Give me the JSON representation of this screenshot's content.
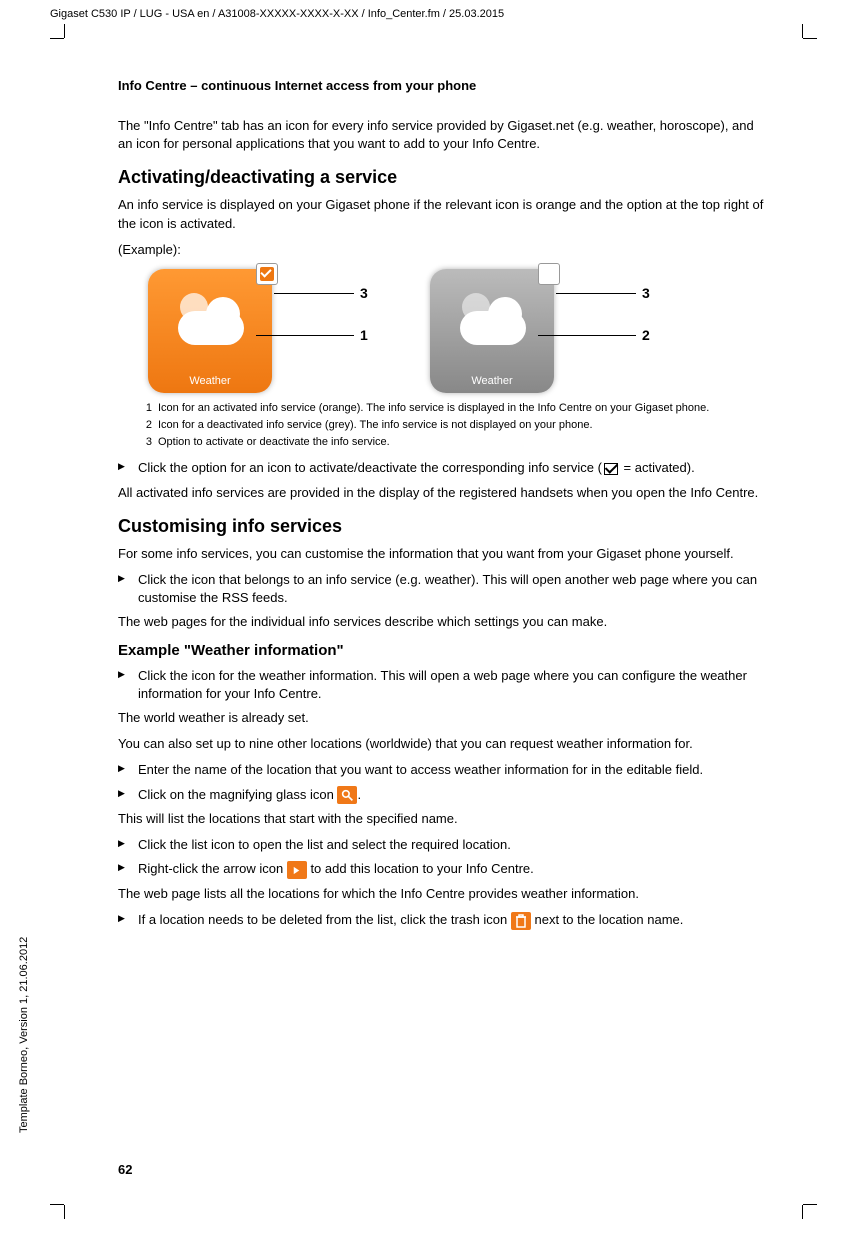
{
  "header": "Gigaset C530 IP / LUG - USA en / A31008-XXXXX-XXXX-X-XX / Info_Center.fm / 25.03.2015",
  "side": "Template Borneo, Version 1, 21.06.2012",
  "page_num": "62",
  "section_title": "Info Centre – continuous Internet access from your phone",
  "intro": "The \"Info Centre\" tab has an icon for every info service provided by Gigaset.net (e.g. weather, horoscope), and an icon for personal applications that you want to add to your Info Centre.",
  "h2_activate": "Activating/deactivating a service",
  "activate_p1": "An info service is displayed on your Gigaset phone if the relevant icon is orange and the option at the top right of the icon is activated.",
  "example_label": "(Example):",
  "tile_label": "Weather",
  "callout": {
    "n1": "1",
    "n2": "2",
    "n3": "3"
  },
  "legend": {
    "n1": "1",
    "t1": "Icon for an activated info service (orange). The info service is displayed in the Info Centre on your Gigaset phone.",
    "n2": "2",
    "t2": "Icon for a deactivated info service (grey). The info service is not displayed on your phone.",
    "n3": "3",
    "t3": "Option to activate or deactivate the info service."
  },
  "step_click_option_a": "Click the option for an icon to activate/deactivate the corresponding info service (",
  "step_click_option_b": " = activated).",
  "activate_p2": "All activated info services are provided in the display of the registered handsets when you open the Info Centre.",
  "h2_custom": "Customising info services",
  "custom_p1": "For some info services, you can customise the information that you want from your Gigaset phone yourself.",
  "custom_step1": "Click the icon that belongs to an info service (e.g. weather). This will open another web page where you can customise the RSS feeds.",
  "custom_p2": "The web pages for the individual info services describe which settings you can make.",
  "h3_example": "Example \"Weather information\"",
  "ex_step1": "Click the icon for the weather information. This will open a web page where you can configure the weather information for your Info Centre.",
  "ex_p1": "The world weather is already set.",
  "ex_p2": "You can also set up to nine other locations (worldwide) that you can request weather information for.",
  "ex_step2": "Enter the name of the location that you want to access weather information for in the editable field.",
  "ex_step3_a": "Click on the magnifying glass icon ",
  "ex_step3_b": ".",
  "ex_p3": "This will list the locations that start with the specified name.",
  "ex_step4": "Click the list icon to open the list and select the required location.",
  "ex_step5_a": "Right-click the arrow icon ",
  "ex_step5_b": " to add this location to your Info Centre.",
  "ex_p4": "The web page lists all the locations for which the Info Centre provides weather information.",
  "ex_step6_a": "If a location needs to be deleted from the list, click the trash icon ",
  "ex_step6_b": " next to the location name."
}
